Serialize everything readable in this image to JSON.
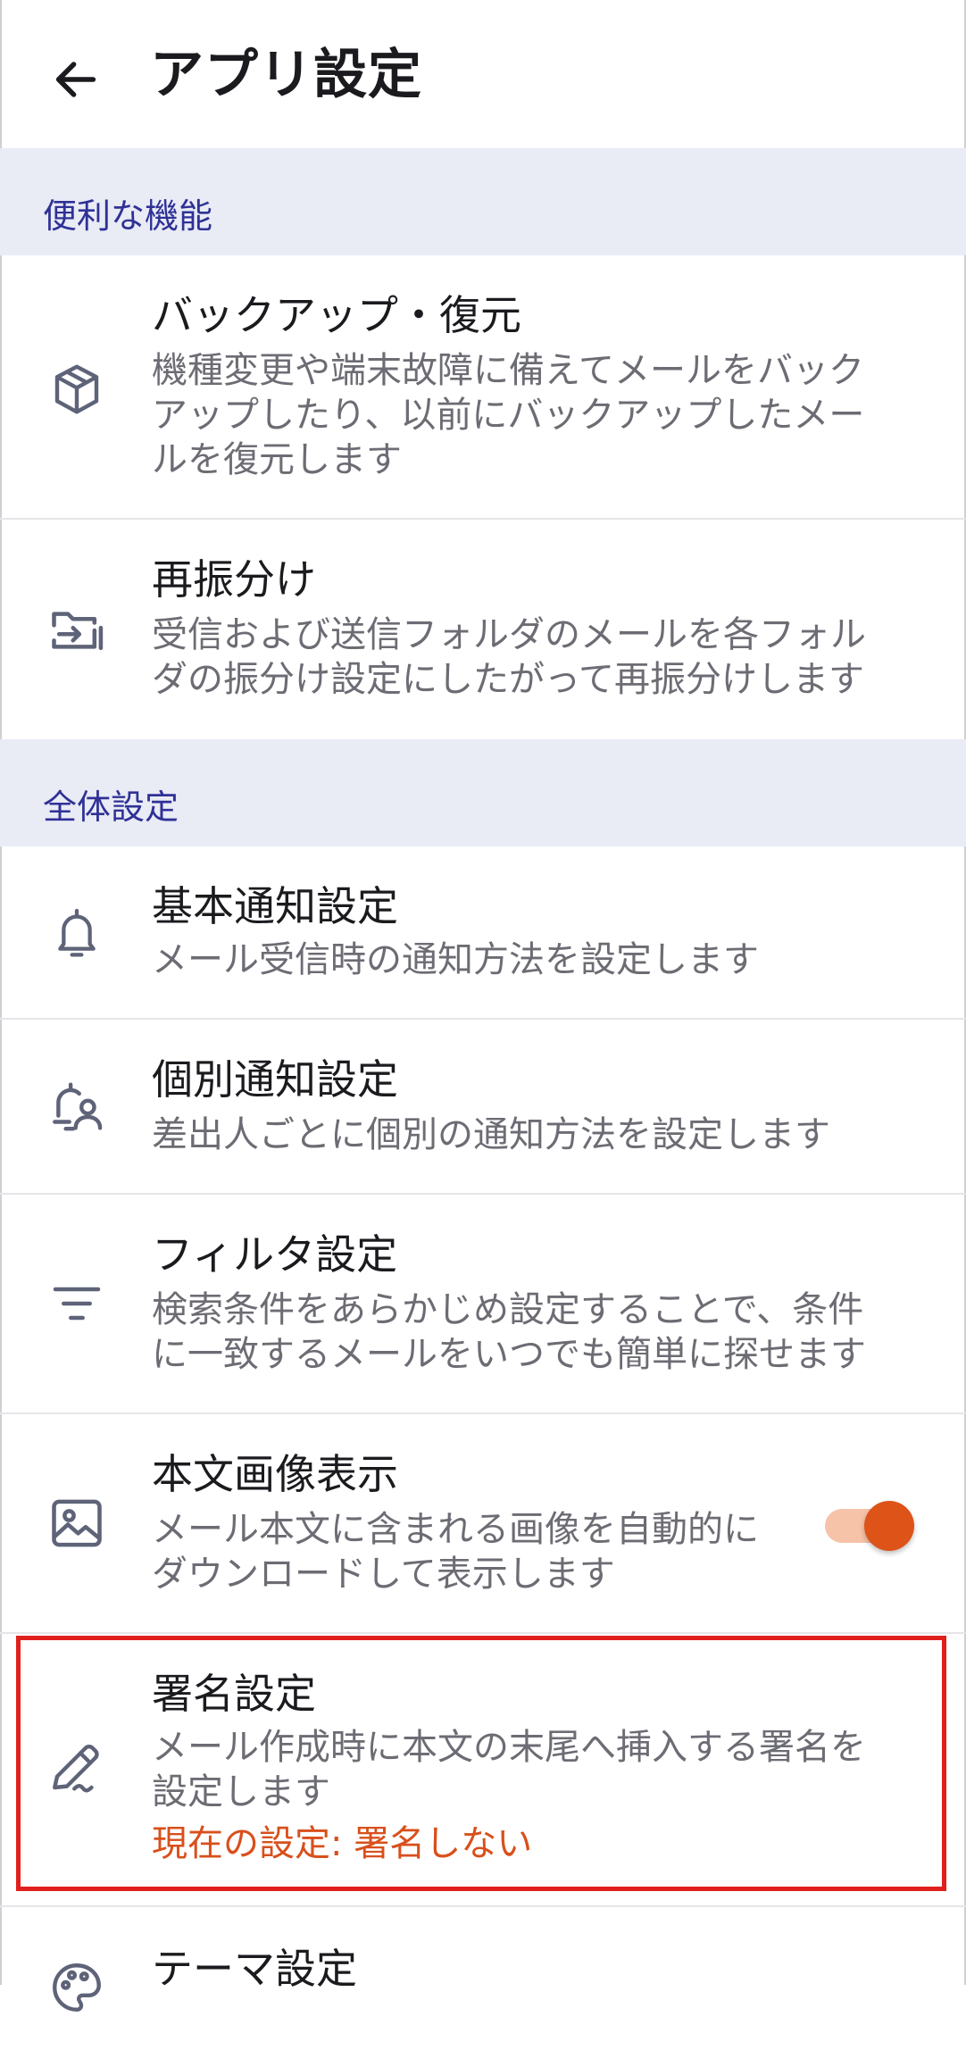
{
  "header": {
    "title": "アプリ設定"
  },
  "sections": [
    {
      "label": "便利な機能"
    },
    {
      "label": "全体設定"
    }
  ],
  "items": {
    "backup": {
      "title": "バックアップ・復元",
      "desc": [
        "機種変更や端末故障に備えてメールをバック",
        "アップしたり、以前にバックアップしたメー",
        "ルを復元します"
      ]
    },
    "resort": {
      "title": "再振分け",
      "desc": [
        "受信および送信フォルダのメールを各フォル",
        "ダの振分け設定にしたがって再振分けします"
      ]
    },
    "basic_notify": {
      "title": "基本通知設定",
      "desc": [
        "メール受信時の通知方法を設定します"
      ]
    },
    "individual_notify": {
      "title": "個別通知設定",
      "desc": [
        "差出人ごとに個別の通知方法を設定します"
      ]
    },
    "filter": {
      "title": "フィルタ設定",
      "desc": [
        "検索条件をあらかじめ設定することで、条件",
        "に一致するメールをいつでも簡単に探せます"
      ]
    },
    "image_display": {
      "title": "本文画像表示",
      "desc": [
        "メール本文に含まれる画像を自動的に",
        "ダウンロードして表示します"
      ],
      "toggle_on": true
    },
    "signature": {
      "title": "署名設定",
      "desc": [
        "メール作成時に本文の末尾へ挿入する署名を",
        "設定します"
      ],
      "current": "現在の設定: 署名しない"
    },
    "theme": {
      "title": "テーマ設定"
    }
  },
  "colors": {
    "section_bg": "#e9ebf5",
    "section_text": "#2f3196",
    "accent": "#dd5318",
    "highlight_border": "#e0201c",
    "icon": "#5e6378"
  },
  "icons": {
    "back": "arrow-left-icon",
    "backup": "box-icon",
    "resort": "folder-move-icon",
    "basic_notify": "bell-icon",
    "individual_notify": "bell-person-icon",
    "filter": "filter-lines-icon",
    "image_display": "image-icon",
    "signature": "pen-icon",
    "theme": "palette-icon"
  }
}
